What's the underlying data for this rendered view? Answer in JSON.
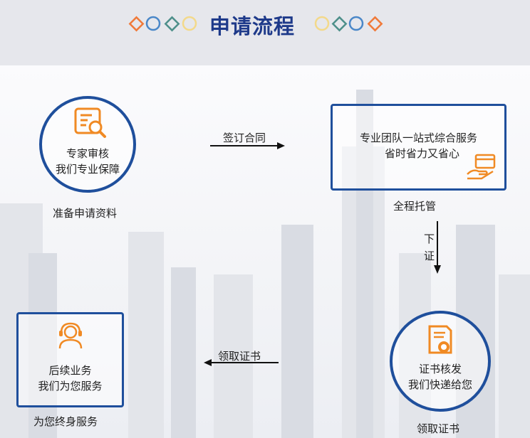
{
  "header": {
    "title": "申请流程"
  },
  "steps": {
    "review": {
      "line1": "专家审核",
      "line2": "我们专业保障",
      "caption": "准备申请资料"
    },
    "team": {
      "line1": "专业团队一站式综合服务",
      "line2": "省时省力又省心",
      "caption": "全程托管"
    },
    "cert": {
      "line1": "证书核发",
      "line2": "我们快递给您",
      "caption": "领取证书"
    },
    "followup": {
      "line1": "后续业务",
      "line2": "我们为您服务",
      "caption": "为您终身服务"
    }
  },
  "arrows": {
    "sign": "签订合同",
    "issue_top": "下",
    "issue_bottom": "证",
    "collect": "领取证书"
  },
  "colors": {
    "accent_blue": "#1f4f9c",
    "title_blue": "#1e3a8a",
    "icon_orange": "#f08a24",
    "deco_orange": "#f07a3a",
    "deco_blue": "#4a87c8",
    "deco_teal": "#4d8f8a",
    "deco_yellow": "#f3d98a"
  }
}
